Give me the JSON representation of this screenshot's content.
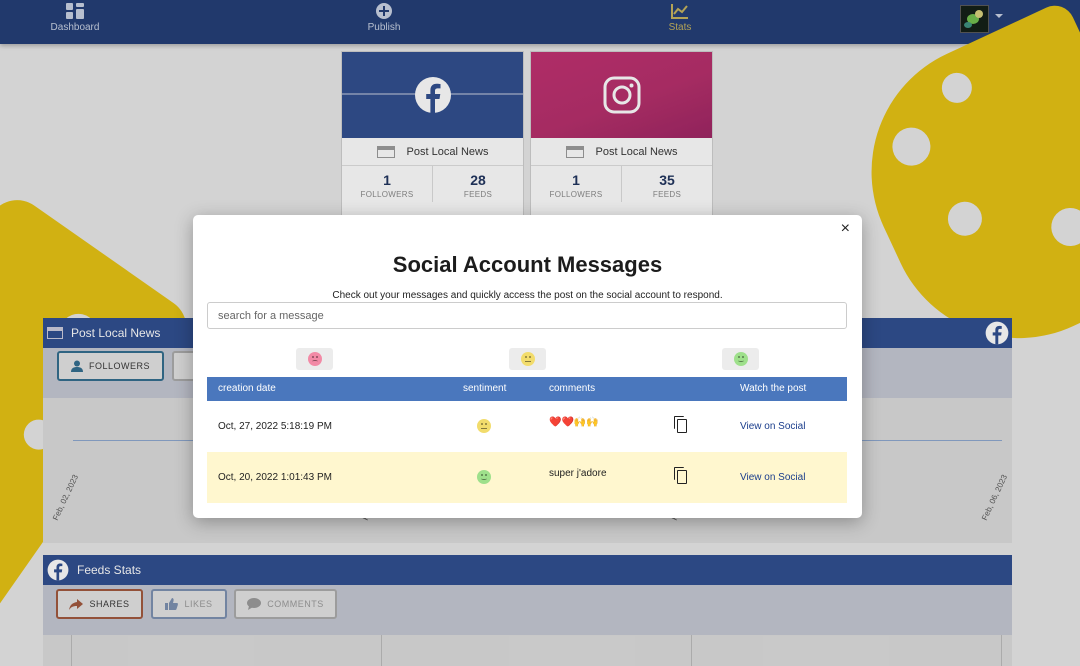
{
  "nav": {
    "items": [
      {
        "label": "Dashboard",
        "icon": "dashboard-icon"
      },
      {
        "label": "Publish",
        "icon": "plus-circle-icon"
      },
      {
        "label": "Stats",
        "icon": "chart-icon"
      }
    ]
  },
  "accounts": [
    {
      "network": "facebook",
      "name": "Post Local News",
      "followers": "1",
      "followers_label": "FOLLOWERS",
      "feeds": "28",
      "feeds_label": "FEEDS",
      "color": "#2c4b8c"
    },
    {
      "network": "instagram",
      "name": "Post Local News",
      "followers": "1",
      "followers_label": "FOLLOWERS",
      "feeds": "35",
      "feeds_label": "FEEDS",
      "color": "#c02c6e"
    }
  ],
  "followers_panel": {
    "title": "Post Local News",
    "buttons": {
      "followers": "FOLLOWERS"
    },
    "ticks": [
      "Feb, 02, 2023",
      "Feb, 0",
      "Feb, 0",
      "Feb, 06, 2023"
    ]
  },
  "feeds_panel": {
    "title": "Feeds Stats",
    "buttons": {
      "shares": "SHARES",
      "likes": "LIKES",
      "comments": "COMMENTS"
    }
  },
  "modal": {
    "close": "×",
    "title": "Social Account Messages",
    "subtitle": "Check out your messages and quickly access the post on the social account to respond.",
    "search_placeholder": "search for a message",
    "columns": {
      "date": "creation date",
      "sentiment": "sentiment",
      "comments": "comments",
      "watch": "Watch the post"
    },
    "rows": [
      {
        "date": "Oct, 27, 2022 5:18:19 PM",
        "sentiment": "neutral",
        "comment": "❤️❤️🙌🙌",
        "link": "View on Social"
      },
      {
        "date": "Oct, 20, 2022 1:01:43 PM",
        "sentiment": "positive",
        "comment": "super j'adore",
        "link": "View on Social"
      }
    ]
  },
  "colors": {
    "nav_bg": "#1e3a73",
    "table_header": "#4a77bd",
    "highlight_row": "#fff7cf",
    "accent_yellow": "#e6c20d"
  }
}
